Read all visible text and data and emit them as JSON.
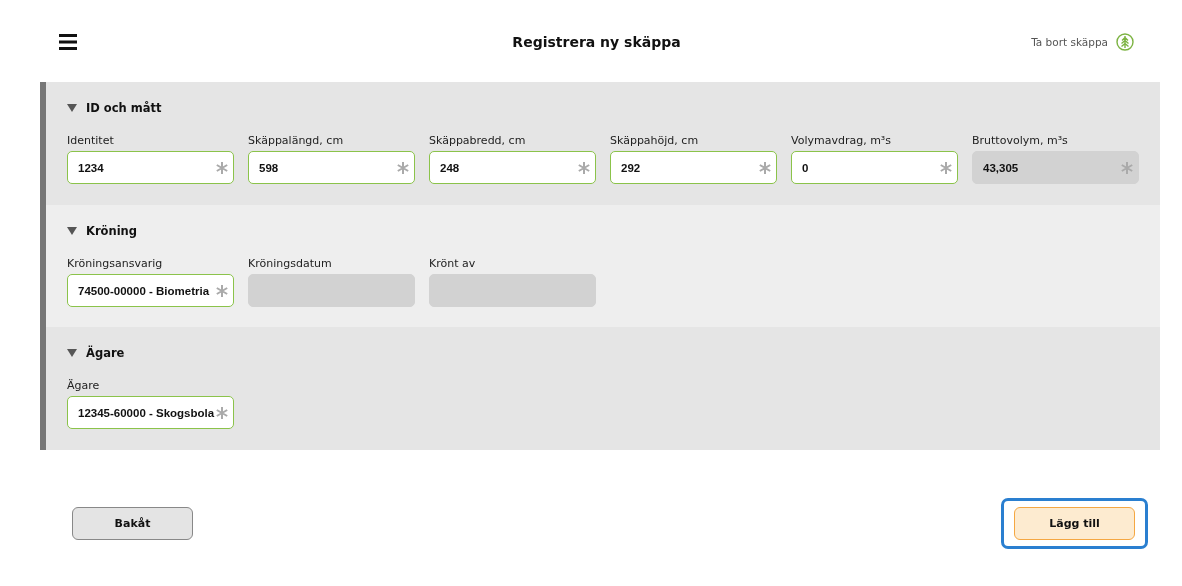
{
  "header": {
    "title": "Registrera ny skäppa",
    "delete_link": "Ta bort skäppa"
  },
  "sections": [
    {
      "title": "ID och mått",
      "expanded": true,
      "fields": [
        {
          "label": "Identitet",
          "value": "1234",
          "required": true,
          "disabled": false
        },
        {
          "label": "Skäppalängd, cm",
          "value": "598",
          "required": true,
          "disabled": false
        },
        {
          "label": "Skäppabredd, cm",
          "value": "248",
          "required": true,
          "disabled": false
        },
        {
          "label": "Skäppahöjd, cm",
          "value": "292",
          "required": true,
          "disabled": false
        },
        {
          "label": "Volymavdrag, m³s",
          "value": "0",
          "required": true,
          "disabled": false
        },
        {
          "label": "Bruttovolym, m³s",
          "value": "43,305",
          "required": true,
          "disabled": true
        }
      ]
    },
    {
      "title": "Kröning",
      "expanded": true,
      "fields": [
        {
          "label": "Kröningsansvarig",
          "value": "74500-00000 - Biometria",
          "required": true,
          "disabled": false
        },
        {
          "label": "Kröningsdatum",
          "required": false,
          "disabled": true
        },
        {
          "label": "Krönt av",
          "required": false,
          "disabled": true
        }
      ]
    },
    {
      "title": "Ägare",
      "expanded": true,
      "fields": [
        {
          "label": "Ägare",
          "value": "12345-60000 - Skogsbola",
          "required": true,
          "disabled": false
        }
      ]
    }
  ],
  "buttons": [
    {
      "label": "Bakåt",
      "kind": "secondary",
      "focused": false
    },
    {
      "label": "Lägg till",
      "kind": "primary",
      "focused": true
    }
  ]
}
